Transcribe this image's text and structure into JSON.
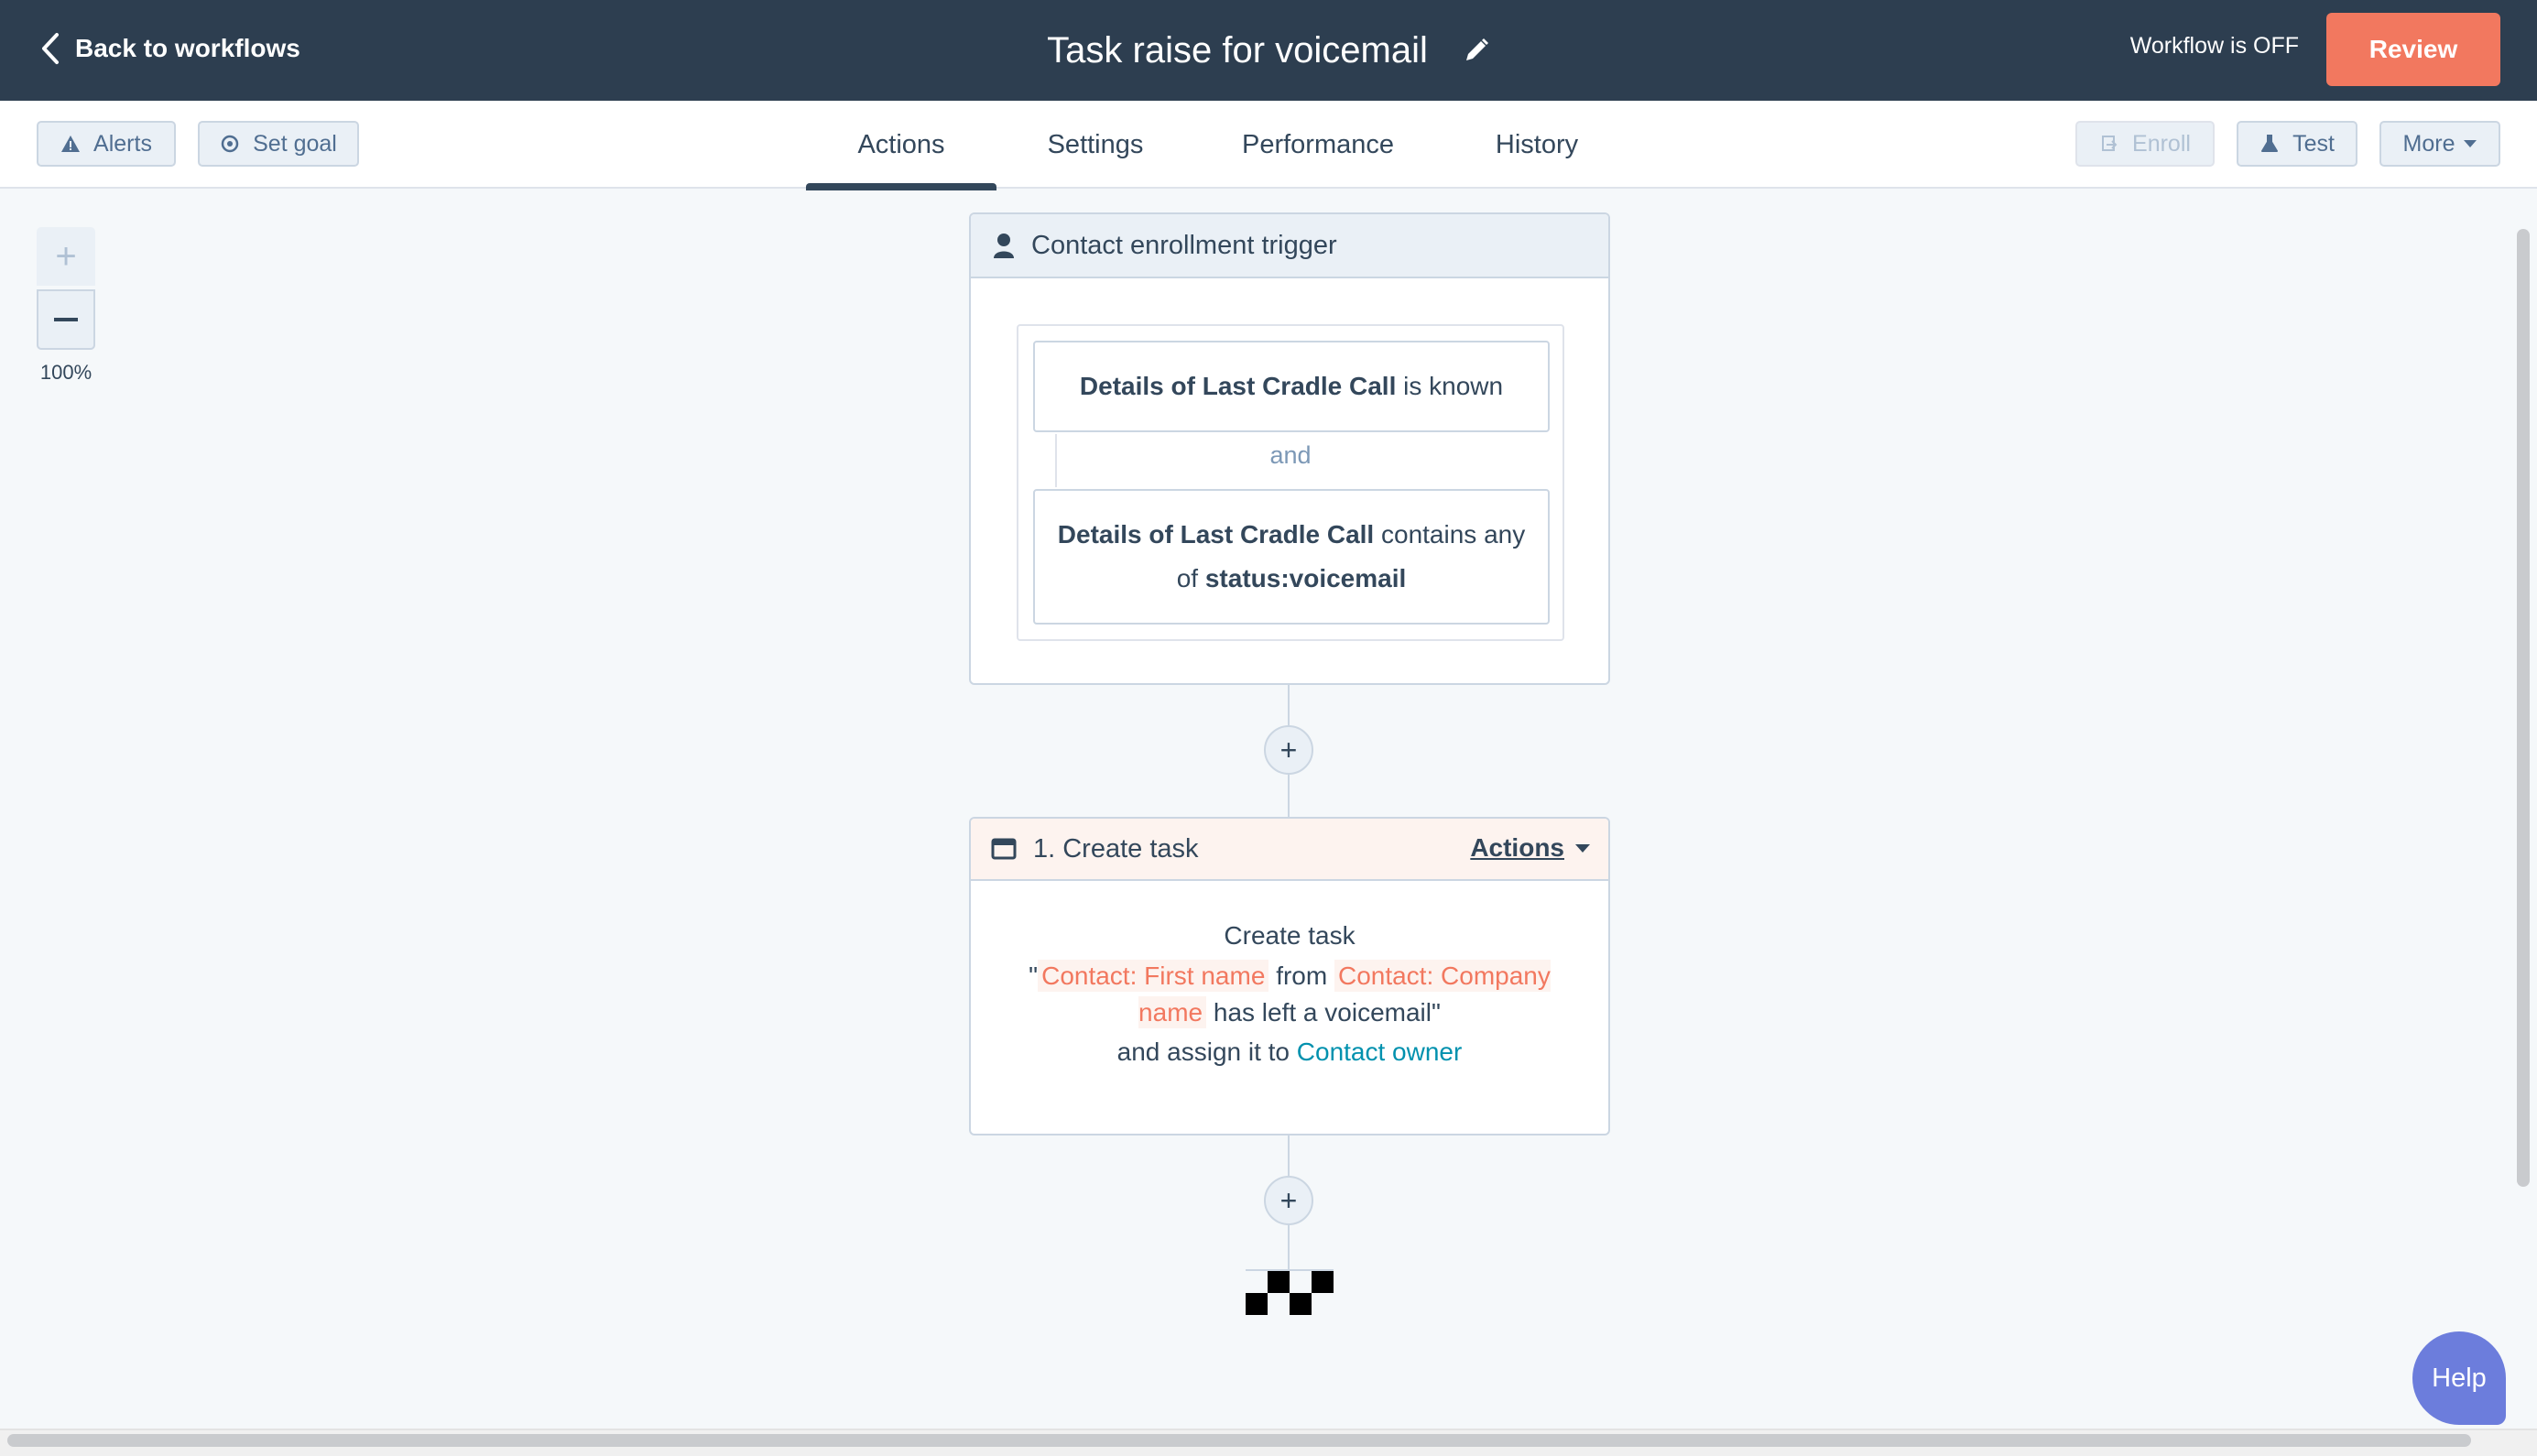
{
  "header": {
    "back_label": "Back to workflows",
    "title": "Task raise for voicemail",
    "status": "Workflow is OFF",
    "review_label": "Review"
  },
  "toolbar": {
    "alerts_label": "Alerts",
    "goal_label": "Set goal",
    "enroll_label": "Enroll",
    "test_label": "Test",
    "more_label": "More"
  },
  "tabs": [
    {
      "label": "Actions",
      "active": true
    },
    {
      "label": "Settings",
      "active": false
    },
    {
      "label": "Performance",
      "active": false
    },
    {
      "label": "History",
      "active": false
    }
  ],
  "zoom": {
    "level": "100%"
  },
  "trigger": {
    "title": "Contact enrollment trigger",
    "filter1": {
      "property": "Details of Last Cradle Call",
      "operator": "is known"
    },
    "joiner": "and",
    "filter2": {
      "property": "Details of Last Cradle Call",
      "operator": "contains any of",
      "value": "status:voicemail"
    }
  },
  "action": {
    "title": "1. Create task",
    "menu_label": "Actions",
    "body_heading": "Create task",
    "quote_open": "\"",
    "token1": "Contact: First name",
    "word_from": "from",
    "token2": "Contact: Company name",
    "suffix": "has left a voicemail\"",
    "assign_text": "and assign it to",
    "assign_link": "Contact owner"
  },
  "help": {
    "label": "Help"
  },
  "colors": {
    "topbar": "#2d3e50",
    "accent": "#f2785f",
    "link": "#0091ae",
    "help": "#6c7ddc"
  },
  "icons": [
    "chevron-left-icon",
    "pencil-icon",
    "warning-icon",
    "target-icon",
    "enroll-icon",
    "flask-icon",
    "caret-down-icon",
    "user-icon",
    "task-icon",
    "plus-icon",
    "minus-icon",
    "checkered-flag-icon"
  ]
}
